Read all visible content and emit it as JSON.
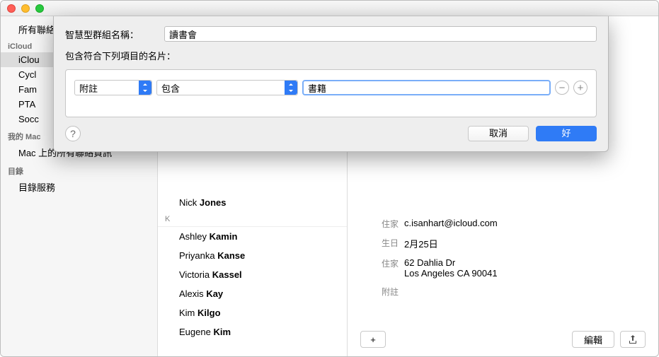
{
  "sidebar": {
    "all": "所有聯絡",
    "sec_icloud": "iCloud",
    "items_icloud": [
      "iClou",
      "Cycl",
      "Fam",
      "PTA",
      "Socc"
    ],
    "sec_mac": "我的 Mac",
    "mac_item": "Mac 上的所有聯絡資訊",
    "sec_dir": "目錄",
    "dir_item": "目錄服務"
  },
  "contacts": {
    "letter": "K",
    "rows": [
      {
        "fn": "Nick",
        "ln": "Jones"
      },
      {
        "fn": "Ashley",
        "ln": "Kamin"
      },
      {
        "fn": "Priyanka",
        "ln": "Kanse"
      },
      {
        "fn": "Victoria",
        "ln": "Kassel"
      },
      {
        "fn": "Alexis",
        "ln": "Kay"
      },
      {
        "fn": "Kim",
        "ln": "Kilgo"
      },
      {
        "fn": "Eugene",
        "ln": "Kim"
      }
    ]
  },
  "detail": {
    "email_label": "住家",
    "email": "c.isanhart@icloud.com",
    "bday_label": "生日",
    "bday": "2月25日",
    "addr_label": "住家",
    "addr1": "62 Dahlia Dr",
    "addr2": "Los Angeles CA 90041",
    "note_label": "附註",
    "add": "+",
    "edit": "編輯",
    "share": "⇪"
  },
  "dialog": {
    "name_label": "智慧型群組名稱：",
    "name_value": "讀書會",
    "cond_label": "包含符合下列項目的名片：",
    "field": "附註",
    "op": "包含",
    "value": "書籍",
    "minus": "−",
    "plus": "+",
    "help": "?",
    "cancel": "取消",
    "ok": "好"
  }
}
